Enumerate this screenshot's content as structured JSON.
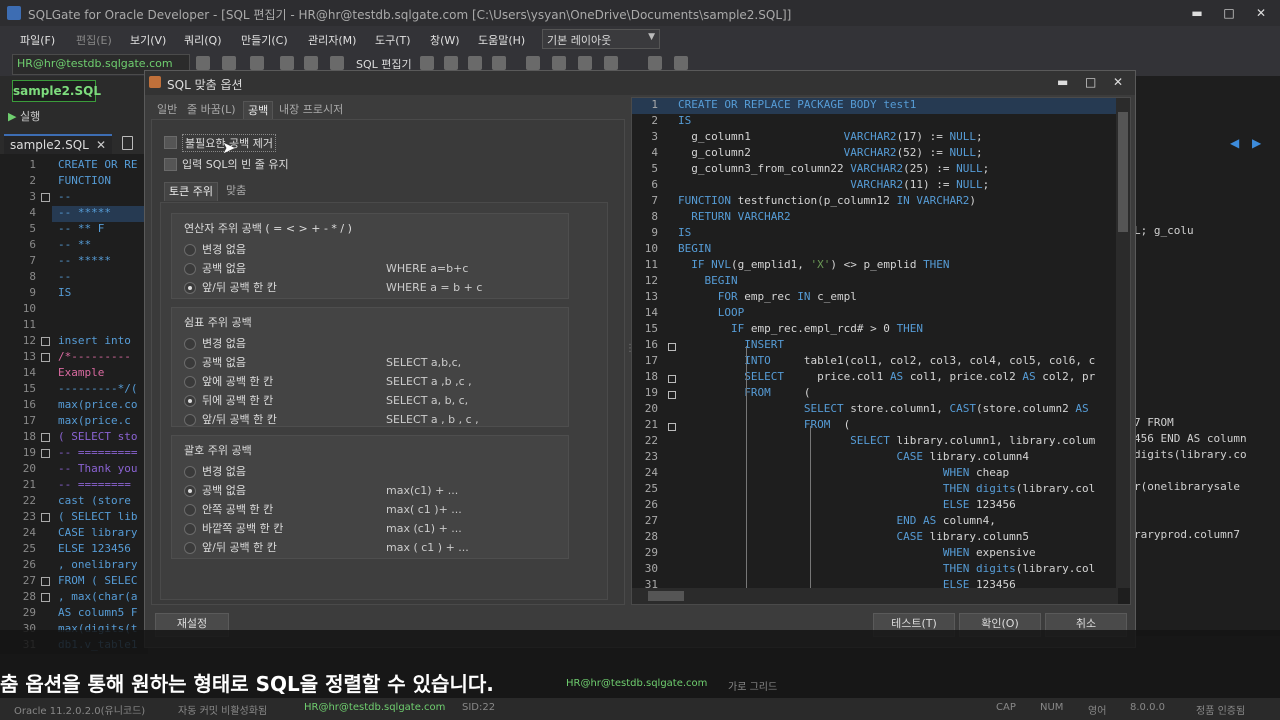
{
  "window": {
    "title": "SQLGate for Oracle Developer - [SQL 편집기 - HR@hr@testdb.sqlgate.com [C:\\Users\\ysyan\\OneDrive\\Documents\\sample2.SQL]]",
    "minimize": "▬",
    "maximize": "□",
    "close": "✕"
  },
  "menubar": {
    "items": [
      "파일(F)",
      "편집(E)",
      "보기(V)",
      "쿼리(Q)",
      "만들기(C)",
      "관리자(M)",
      "도구(T)",
      "창(W)",
      "도움말(H)"
    ],
    "layout_combo": "기본 레이아웃"
  },
  "toolbar": {
    "connection": "HR@hr@testdb.sqlgate.com",
    "sql_editor_label": "SQL 편집기"
  },
  "doc": {
    "active_tab": "sample2.SQL",
    "run_label": "실행",
    "editor_tab": "sample2.SQL"
  },
  "bg_editor": {
    "line_numbers": [
      "1",
      "2",
      "3",
      "4",
      "5",
      "6",
      "7",
      "8",
      "9",
      "10",
      "11",
      "12",
      "13",
      "14",
      "15",
      "16",
      "17",
      "18",
      "19",
      "20",
      "21",
      "22",
      "23",
      "24",
      "25",
      "26",
      "27",
      "28",
      "29",
      "30",
      "31"
    ],
    "fragments": [
      "CREATE OR RE",
      "  FUNCTION",
      "    --",
      "    -- *****",
      "      -- ** F",
      "    -- **",
      "    -- *****",
      "    --",
      "      IS",
      "",
      "",
      " insert into",
      "/*---------",
      "Example",
      "---------*/(",
      "max(price.co",
      " max(price.c",
      "( SELECT sto",
      "-- =========",
      "-- Thank you",
      " -- ========",
      " cast (store",
      "( SELECT lib",
      "CASE library",
      "ELSE 123456",
      ", onelibrary",
      "FROM ( SELEC",
      ", max(char(a",
      "AS column5 F",
      "max(digits(t",
      "db1.v_table1"
    ],
    "right_fragments": [
      {
        "text": "L;          g_colu",
        "line": 10
      },
      {
        "text": "7  FROM",
        "line": 22
      },
      {
        "text": "456 END AS column",
        "line": 23
      },
      {
        "text": "digits(library.co",
        "line": 24
      },
      {
        "text": "r(onelibrarysale",
        "line": 26
      },
      {
        "text": "raryprod.column7",
        "line": 29
      }
    ]
  },
  "dialog": {
    "title": "SQL 맞춤 옵션",
    "tabs": [
      "일반",
      "줄 바꿈(L)",
      "공백",
      "내장 프로시저"
    ],
    "active_tab_index": 2,
    "checkbox_remove_spaces": "불필요한 공백 제거",
    "checkbox_keep_blank_lines": "입력 SQL의 빈 줄 유지",
    "subtabs": [
      "토큰 주위",
      "맞춤"
    ],
    "groups": [
      {
        "title": "연산자 주위 공백 ( = < > + - * / )",
        "options": [
          {
            "label": "변경 없음",
            "example": "",
            "selected": false
          },
          {
            "label": "공백 없음",
            "example": "WHERE a=b+c",
            "selected": false
          },
          {
            "label": "앞/뒤 공백 한 칸",
            "example": "WHERE a = b + c",
            "selected": true
          }
        ]
      },
      {
        "title": "쉼표 주위 공백",
        "options": [
          {
            "label": "변경 없음",
            "example": "",
            "selected": false
          },
          {
            "label": "공백 없음",
            "example": "SELECT a,b,c,",
            "selected": false
          },
          {
            "label": "앞에 공백 한 칸",
            "example": "SELECT a ,b ,c ,",
            "selected": false
          },
          {
            "label": "뒤에 공백 한 칸",
            "example": "SELECT a, b, c,",
            "selected": true
          },
          {
            "label": "앞/뒤 공백 한 칸",
            "example": "SELECT a , b , c ,",
            "selected": false
          }
        ]
      },
      {
        "title": "괄호 주위 공백",
        "options": [
          {
            "label": "변경 없음",
            "example": "",
            "selected": false
          },
          {
            "label": "공백 없음",
            "example": "max(c1) + ...",
            "selected": true
          },
          {
            "label": "안쪽 공백 한 칸",
            "example": "max( c1 )+ ...",
            "selected": false
          },
          {
            "label": "바깥쪽 공백 한 칸",
            "example": "max (c1) + ...",
            "selected": false
          },
          {
            "label": "앞/뒤 공백 한 칸",
            "example": "max ( c1 ) + ...",
            "selected": false
          }
        ]
      }
    ],
    "buttons": {
      "reset": "재설정",
      "test": "테스트(T)",
      "ok": "확인(O)",
      "cancel": "취소"
    }
  },
  "preview": {
    "lines": [
      {
        "n": "1",
        "code": [
          [
            "kw",
            "CREATE OR REPLACE PACKAGE BODY "
          ],
          [
            "kw",
            "test1"
          ]
        ],
        "fold": false
      },
      {
        "n": "2",
        "code": [
          [
            "kw",
            "IS"
          ]
        ],
        "fold": false
      },
      {
        "n": "3",
        "code": [
          [
            "tx",
            "  g_column1              "
          ],
          [
            "kw",
            "VARCHAR2"
          ],
          [
            "tx",
            "(17) := "
          ],
          [
            "kw",
            "NULL"
          ],
          [
            "tx",
            ";"
          ]
        ],
        "fold": false
      },
      {
        "n": "4",
        "code": [
          [
            "tx",
            "  g_column2              "
          ],
          [
            "kw",
            "VARCHAR2"
          ],
          [
            "tx",
            "(52) := "
          ],
          [
            "kw",
            "NULL"
          ],
          [
            "tx",
            ";"
          ]
        ],
        "fold": false
      },
      {
        "n": "5",
        "code": [
          [
            "tx",
            "  g_column3_from_column22 "
          ],
          [
            "kw",
            "VARCHAR2"
          ],
          [
            "tx",
            "(25) := "
          ],
          [
            "kw",
            "NULL"
          ],
          [
            "tx",
            ";"
          ]
        ],
        "fold": false
      },
      {
        "n": "6",
        "code": [
          [
            "tx",
            "                          "
          ],
          [
            "kw",
            "VARCHAR2"
          ],
          [
            "tx",
            "(11) := "
          ],
          [
            "kw",
            "NULL"
          ],
          [
            "tx",
            ";"
          ]
        ],
        "fold": false
      },
      {
        "n": "7",
        "code": [
          [
            "kw",
            "FUNCTION "
          ],
          [
            "tx",
            "testfunction(p_column12 "
          ],
          [
            "kw",
            "IN VARCHAR2"
          ],
          [
            "tx",
            ")"
          ]
        ],
        "fold": false
      },
      {
        "n": "8",
        "code": [
          [
            "kw",
            "  RETURN VARCHAR2"
          ]
        ],
        "fold": false
      },
      {
        "n": "9",
        "code": [
          [
            "kw",
            "IS"
          ]
        ],
        "fold": false
      },
      {
        "n": "10",
        "code": [
          [
            "kw",
            "BEGIN"
          ]
        ],
        "fold": false
      },
      {
        "n": "11",
        "code": [
          [
            "kw",
            "  IF NVL"
          ],
          [
            "tx",
            "(g_emplid1, "
          ],
          [
            "st",
            "'X'"
          ],
          [
            "tx",
            ") <> p_emplid "
          ],
          [
            "kw",
            "THEN"
          ]
        ],
        "fold": false
      },
      {
        "n": "12",
        "code": [
          [
            "kw",
            "    BEGIN"
          ]
        ],
        "fold": false
      },
      {
        "n": "13",
        "code": [
          [
            "kw",
            "      FOR "
          ],
          [
            "tx",
            "emp_rec "
          ],
          [
            "kw",
            "IN "
          ],
          [
            "tx",
            "c_empl"
          ]
        ],
        "fold": false
      },
      {
        "n": "14",
        "code": [
          [
            "kw",
            "      LOOP"
          ]
        ],
        "fold": false
      },
      {
        "n": "15",
        "code": [
          [
            "kw",
            "        IF "
          ],
          [
            "tx",
            "emp_rec.empl_rcd# > 0 "
          ],
          [
            "kw",
            "THEN"
          ]
        ],
        "fold": false
      },
      {
        "n": "16",
        "code": [
          [
            "kw",
            "          INSERT"
          ]
        ],
        "fold": true
      },
      {
        "n": "17",
        "code": [
          [
            "kw",
            "          INTO     "
          ],
          [
            "tx",
            "table1(col1, col2, col3, col4, col5, col6, c"
          ]
        ],
        "fold": false
      },
      {
        "n": "18",
        "code": [
          [
            "kw",
            "          SELECT     "
          ],
          [
            "tx",
            "price.col1 "
          ],
          [
            "kw",
            "AS "
          ],
          [
            "tx",
            "col1, price.col2 "
          ],
          [
            "kw",
            "AS "
          ],
          [
            "tx",
            "col2, pr"
          ]
        ],
        "fold": true
      },
      {
        "n": "19",
        "code": [
          [
            "kw",
            "          FROM     "
          ],
          [
            "tx",
            "("
          ]
        ],
        "fold": true
      },
      {
        "n": "20",
        "code": [
          [
            "kw",
            "                   SELECT "
          ],
          [
            "tx",
            "store.column1, "
          ],
          [
            "kw",
            "CAST"
          ],
          [
            "tx",
            "(store.column2 "
          ],
          [
            "kw",
            "AS"
          ]
        ],
        "fold": false
      },
      {
        "n": "21",
        "code": [
          [
            "kw",
            "                   FROM  "
          ],
          [
            "tx",
            "("
          ]
        ],
        "fold": true
      },
      {
        "n": "22",
        "code": [
          [
            "kw",
            "                          SELECT "
          ],
          [
            "tx",
            "library.column1, library.colum"
          ]
        ],
        "fold": false
      },
      {
        "n": "23",
        "code": [
          [
            "kw",
            "                                 CASE "
          ],
          [
            "tx",
            "library.column4"
          ]
        ],
        "fold": false
      },
      {
        "n": "24",
        "code": [
          [
            "kw",
            "                                        WHEN "
          ],
          [
            "tx",
            "cheap"
          ]
        ],
        "fold": false
      },
      {
        "n": "25",
        "code": [
          [
            "kw",
            "                                        THEN digits"
          ],
          [
            "tx",
            "(library.col"
          ]
        ],
        "fold": false
      },
      {
        "n": "26",
        "code": [
          [
            "kw",
            "                                        ELSE "
          ],
          [
            "tx",
            "123456"
          ]
        ],
        "fold": false
      },
      {
        "n": "27",
        "code": [
          [
            "kw",
            "                                 END AS "
          ],
          [
            "tx",
            "column4,"
          ]
        ],
        "fold": false
      },
      {
        "n": "28",
        "code": [
          [
            "kw",
            "                                 CASE "
          ],
          [
            "tx",
            "library.column5"
          ]
        ],
        "fold": false
      },
      {
        "n": "29",
        "code": [
          [
            "kw",
            "                                        WHEN "
          ],
          [
            "tx",
            "expensive"
          ]
        ],
        "fold": false
      },
      {
        "n": "30",
        "code": [
          [
            "kw",
            "                                        THEN digits"
          ],
          [
            "tx",
            "(library.col"
          ]
        ],
        "fold": false
      },
      {
        "n": "31",
        "code": [
          [
            "kw",
            "                                        ELSE "
          ],
          [
            "tx",
            "123456"
          ]
        ],
        "fold": false
      }
    ]
  },
  "subtitle": "춤 옵션을 통해 원하는 형태로 SQL을 정렬할 수 있습니다.",
  "statusbar": {
    "oracle": "Oracle 11.2.0.2.0(유니코드)",
    "autocommit": "자동 커밋 비활성화됨",
    "connection": "HR@hr@testdb.sqlgate.com",
    "sid": "SID:22",
    "cap": "CAP",
    "num": "NUM",
    "lang": "영어",
    "version": "8.0.0.0",
    "license": "정품 인증됨",
    "overlay_connection": "HR@hr@testdb.sqlgate.com",
    "overlay_grid": "가로 그리드"
  }
}
